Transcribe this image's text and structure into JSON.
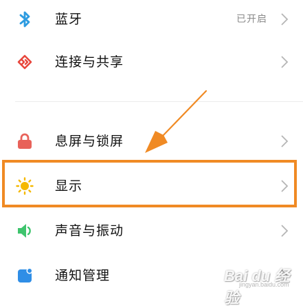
{
  "settings": {
    "items": [
      {
        "label": "蓝牙",
        "status": "已开启",
        "icon": "bluetooth-icon"
      },
      {
        "label": "连接与共享",
        "icon": "connection-sharing-icon"
      },
      {
        "label": "息屏与锁屏",
        "icon": "lock-icon"
      },
      {
        "label": "显示",
        "icon": "sun-icon"
      },
      {
        "label": "声音与振动",
        "icon": "speaker-icon"
      },
      {
        "label": "通知管理",
        "icon": "notification-icon"
      }
    ]
  },
  "watermark": {
    "text": "Bai du 经验",
    "sub": "jingyan.baidu.com"
  },
  "colors": {
    "highlight": "#f08a24",
    "bluetooth": "#2d9be0",
    "connection": "#e8463c",
    "lock": "#e8625a",
    "sun": "#f5b800",
    "speaker": "#3ec46d",
    "notification": "#2f8ee6"
  }
}
